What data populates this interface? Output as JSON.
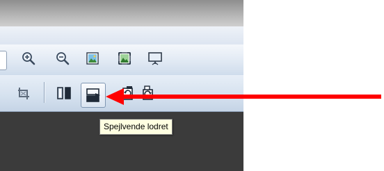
{
  "toolbar_top": {
    "items": [
      {
        "icon": "zoom-in-icon"
      },
      {
        "icon": "zoom-out-icon"
      },
      {
        "icon": "fit-image-icon"
      },
      {
        "icon": "actual-size-icon"
      },
      {
        "icon": "slideshow-icon"
      }
    ]
  },
  "toolbar_bottom": {
    "items": [
      {
        "icon": "crop-icon"
      },
      {
        "icon": "mirror-horizontal-icon"
      },
      {
        "icon": "mirror-vertical-icon",
        "highlighted": true
      },
      {
        "icon": "rotate-left-icon"
      },
      {
        "icon": "rotate-right-icon"
      }
    ]
  },
  "tooltip": {
    "text": "Spejlvende lodret"
  },
  "annotation": {
    "arrow_color": "#ff0000"
  },
  "colors": {
    "toolbar_accent": "#dfe8f3",
    "workspace": "#3b3b3b"
  }
}
